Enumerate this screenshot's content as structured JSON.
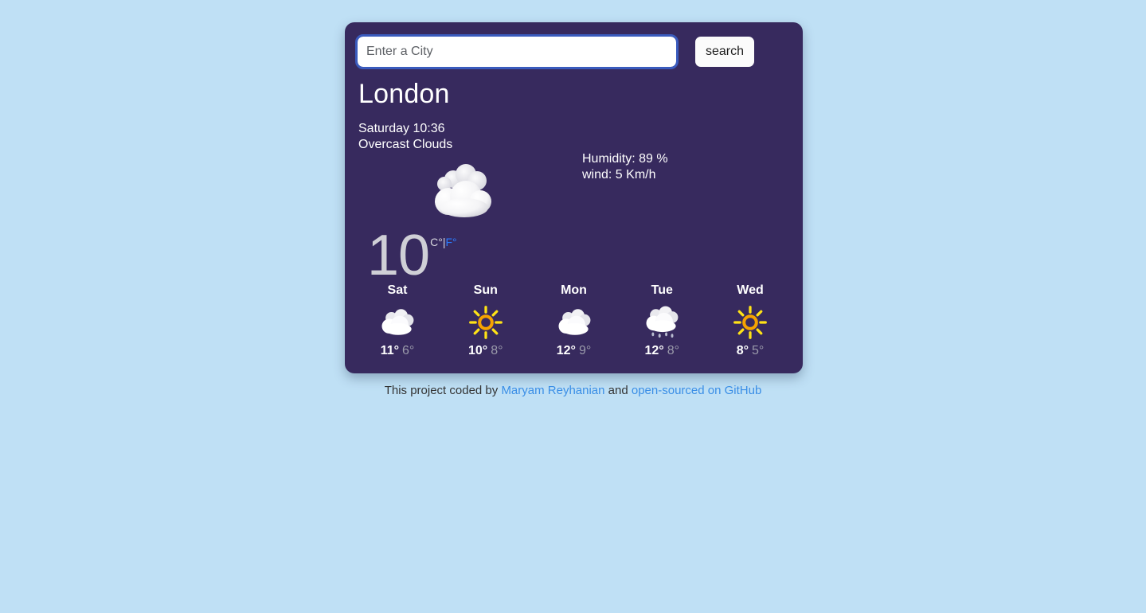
{
  "page": {
    "background_color": "#bfe0f5",
    "card_color": "#372a5e"
  },
  "search": {
    "placeholder": "Enter a City",
    "value": "",
    "button_label": "search"
  },
  "current": {
    "city": "London",
    "datetime": "Saturday 10:36",
    "description": "Overcast Clouds",
    "humidity_label": "Humidity: 89 %",
    "wind_label": "wind: 5 Km/h",
    "temperature": "10",
    "unit_celsius": "C°",
    "unit_separator": "|",
    "unit_fahrenheit": "F°",
    "icon": "overcast-cloud-icon",
    "accent_link_color": "#2b7cff"
  },
  "forecast": [
    {
      "day": "Sat",
      "icon": "cloud-icon",
      "max": "11°",
      "min": "6°"
    },
    {
      "day": "Sun",
      "icon": "sun-icon",
      "max": "10°",
      "min": "8°"
    },
    {
      "day": "Mon",
      "icon": "cloud-icon",
      "max": "12°",
      "min": "9°"
    },
    {
      "day": "Tue",
      "icon": "cloud-rain-icon",
      "max": "12°",
      "min": "8°"
    },
    {
      "day": "Wed",
      "icon": "sun-icon",
      "max": "8°",
      "min": "5°"
    }
  ],
  "footer": {
    "prefix": "This project coded by ",
    "author_link": "Maryam Reyhanian",
    "middle": " and ",
    "source_link": "open-sourced on GitHub"
  }
}
